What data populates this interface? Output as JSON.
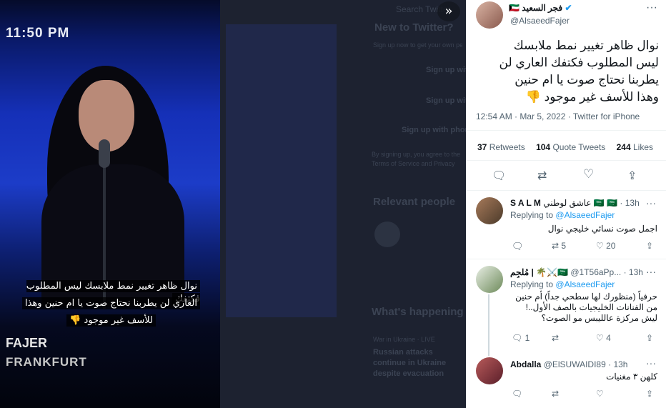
{
  "media": {
    "time": "11:50 PM",
    "caption_lines": [
      "نوال ظاهر تغيير نمط ملابسك ليس المطلوب فكتفك",
      "العاري لن يطربنا نحتاج صوت  يا ام حنين وهذا",
      "للأسف غير موجود 👎"
    ],
    "watermark_name": "FAJER",
    "watermark_city": "FRANKFURT"
  },
  "background": {
    "search_placeholder": "Search Twitter",
    "new_to_twitter": "New to Twitter?",
    "signup_hint": "Sign up now to get your own personalized timeline!",
    "signup_google": "Sign up with Google",
    "signup_apple": "Sign up with Apple",
    "signup_phone": "Sign up with phone or email",
    "terms": "By signing up, you agree to the Terms of Service and Privacy Policy, including Cookie Use.",
    "relevant_people": "Relevant people",
    "whats_happening": "What's happening",
    "trend_context": "War in Ukraine · LIVE",
    "trend_text": "Russian attacks continue in Ukraine despite evacuation route, despite declaring a ceasefire"
  },
  "tweet": {
    "display_name": "فجر السعيد",
    "flag": "🇰🇼",
    "handle": "@AlsaeedFajer",
    "text_lines": [
      "نوال ظاهر تغيير نمط ملابسك",
      "ليس المطلوب فكتفك العاري لن",
      "يطربنا نحتاج صوت  يا ام حنين",
      "وهذا للأسف غير موجود 👎"
    ],
    "timestamp": "12:54 AM · Mar 5, 2022 · Twitter for iPhone",
    "retweets": "37",
    "retweets_label": "Retweets",
    "quote_tweets": "104",
    "quote_tweets_label": "Quote Tweets",
    "likes": "244",
    "likes_label": "Likes"
  },
  "replies": [
    {
      "name": "S A L M",
      "name_extra": "عاشق لوطني 🇸🇦 🇸🇦",
      "time": "· 13h",
      "replying_label": "Replying to",
      "replying_to": "@AlsaeedFajer",
      "text": "اجمل صوت نسائي خليجي نوال",
      "reply_count": "",
      "retweet_count": "5",
      "like_count": "20"
    },
    {
      "name": "مُلجِم | 🌴⚔️🇸🇦",
      "handle": "@1T56aPp...",
      "time": "· 13h",
      "replying_label": "Replying to",
      "replying_to": "@AlsaeedFajer",
      "text_lines": [
        "حرفياً (منظورك لها سطحي جداً) أم حنين",
        "من الفنانات الخليجيات بالصف الأول..!",
        "ليش مركزة عالليبس مو الصوت؟"
      ],
      "reply_count": "1",
      "retweet_count": "",
      "like_count": "4"
    },
    {
      "name": "Abdalla",
      "handle": "@ElSUWAIDI89",
      "time": "· 13h",
      "text": "كلهن ٣ مغنيات",
      "reply_count": "",
      "retweet_count": "",
      "like_count": ""
    }
  ],
  "colors": {
    "accent": "#1d9bf0",
    "verified": "#1d9bf0",
    "text": "#0f1419",
    "muted": "#536471"
  },
  "icons": [
    "expand-icon",
    "verified-icon",
    "more-icon",
    "reply-icon",
    "retweet-icon",
    "like-icon",
    "share-icon"
  ]
}
